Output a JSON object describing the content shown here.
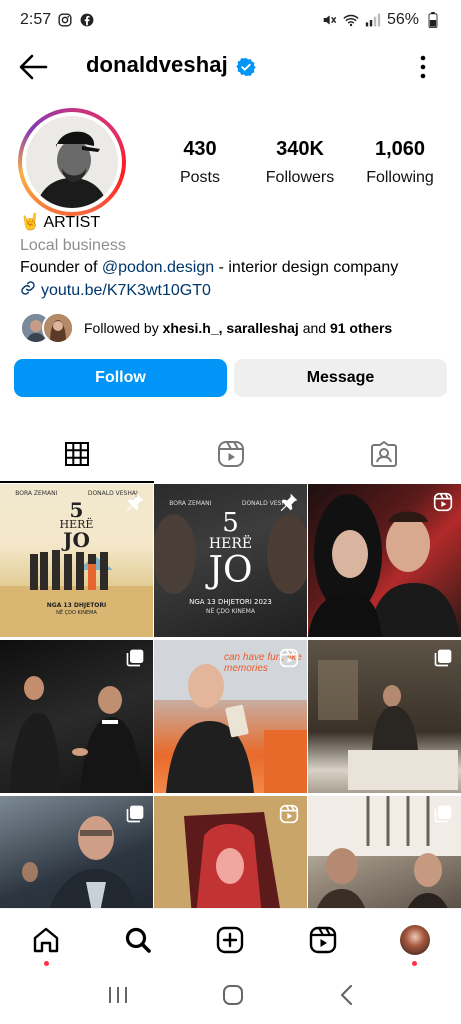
{
  "status_bar": {
    "time": "2:57",
    "battery": "56%"
  },
  "header": {
    "username": "donaldveshaj"
  },
  "stats": [
    {
      "value": "430",
      "label": "Posts"
    },
    {
      "value": "340K",
      "label": "Followers"
    },
    {
      "value": "1,060",
      "label": "Following"
    }
  ],
  "bio": {
    "title_emoji": "🤘",
    "title": "ARTIST",
    "category": "Local business",
    "line_prefix": "Founder of ",
    "mention": "@podon.design",
    "line_suffix": " - interior design company",
    "link": "youtu.be/K7K3wt10GT0"
  },
  "followed_by": {
    "prefix": "Followed by ",
    "user1": "xhesi.h_",
    "sep": ", ",
    "user2": "saralleshaj",
    "mid": " and ",
    "count": "91 others"
  },
  "buttons": {
    "follow": "Follow",
    "message": "Message"
  },
  "posts": {
    "poster1": {
      "names_left": "BORA ZEMANI",
      "names_right": "DONALD VESHAJ",
      "title_top": "5",
      "title_mid": "HERË",
      "title_bot": "JO",
      "date": "NGA 13 DHJETORI",
      "sub": "NË ÇDO KINEMA"
    },
    "poster2": {
      "names_left": "BORA ZEMANI",
      "names_right": "DONALD VESHAJ",
      "title_top": "5",
      "title_mid": "HERË",
      "title_bot": "JO",
      "date": "NGA 13 DHJETORI 2023",
      "sub": "NË ÇDO KINEMA"
    },
    "tile5_sign": "can have fun, like memories"
  },
  "colors": {
    "accent": "#0095f6",
    "notification": "#ff3040",
    "mention": "#00376b"
  }
}
